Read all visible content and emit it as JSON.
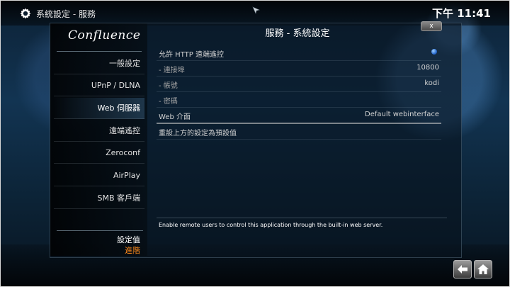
{
  "header": {
    "section": "系統設定",
    "separator": "-",
    "page": "服務",
    "clock": "下午 11:41"
  },
  "app": {
    "logo_text": "Confluence"
  },
  "dialog": {
    "title": "服務 - 系統設定",
    "close_label": "x"
  },
  "sidebar": {
    "items": [
      {
        "label": "一般設定",
        "active": false
      },
      {
        "label": "UPnP / DLNA",
        "active": false
      },
      {
        "label": "Web 伺服器",
        "active": true
      },
      {
        "label": "遠端遙控",
        "active": false
      },
      {
        "label": "Zeroconf",
        "active": false
      },
      {
        "label": "AirPlay",
        "active": false
      },
      {
        "label": "SMB 客戶端",
        "active": false
      }
    ],
    "footer_label": "設定值",
    "footer_level": "進階"
  },
  "settings": [
    {
      "label": "允許 HTTP 遠端遙控",
      "value": "",
      "toggle": true
    },
    {
      "label": "- 連接埠",
      "value": "10800"
    },
    {
      "label": "- 帳號",
      "value": "kodi"
    },
    {
      "label": "- 密碼",
      "value": ""
    },
    {
      "label": "Web 介面",
      "value": "Default webinterface"
    },
    {
      "label": "重設上方的設定為預設值",
      "value": ""
    }
  ],
  "help_text": "Enable remote users to control this application through the built-in web server.",
  "bottom_buttons": {
    "back": "back-arrow-icon",
    "home": "home-icon"
  },
  "colors": {
    "accent": "#ff8a1a",
    "toggle_on": "#2a6bd1"
  }
}
